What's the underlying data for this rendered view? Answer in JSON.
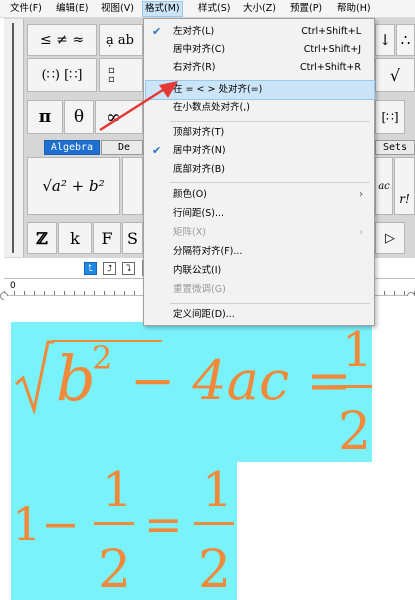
{
  "menubar": {
    "items": [
      "文件(F)",
      "编辑(E)",
      "视图(V)",
      "格式(M)",
      "样式(S)",
      "大小(Z)",
      "预置(P)",
      "帮助(H)"
    ],
    "active_index": 3
  },
  "palette": {
    "row1": [
      "≤ ≠ ≈",
      "ạ ab",
      "↓",
      "∴"
    ],
    "row2": [
      "(∷) [∷]",
      "√"
    ],
    "row3": [
      "π",
      "θ",
      "∞",
      "[∷]"
    ],
    "tabs": [
      "Algebra",
      "De",
      "Sets"
    ],
    "template_sqrt": "√a² + b²",
    "row5": [
      "ℤ",
      "k",
      "F",
      "S",
      "▷"
    ],
    "ruler_zero": "0"
  },
  "format_menu": {
    "items": [
      {
        "label": "左对齐(L)",
        "shortcut": "Ctrl+Shift+L",
        "checked": true
      },
      {
        "label": "居中对齐(C)",
        "shortcut": "Ctrl+Shift+J"
      },
      {
        "label": "右对齐(R)",
        "shortcut": "Ctrl+Shift+R"
      },
      {
        "label": "在 = < > 处对齐(=)",
        "highlighted": true
      },
      {
        "label": "在小数点处对齐(,)"
      },
      {
        "label": "顶部对齐(T)"
      },
      {
        "label": "居中对齐(N)",
        "checked": true
      },
      {
        "label": "底部对齐(B)"
      },
      {
        "label": "颜色(O)",
        "submenu": true
      },
      {
        "label": "行间距(S)..."
      },
      {
        "label": "矩阵(X)",
        "submenu": true,
        "disabled": true
      },
      {
        "label": "分隔符对齐(F)..."
      },
      {
        "label": "内联公式(I)"
      },
      {
        "label": "重置微调(G)",
        "disabled": true
      },
      {
        "label": "定义间距(D)..."
      }
    ]
  },
  "equations": {
    "eq1_b": "b",
    "eq1_sup": "2",
    "eq1_rest": "− 4ac =",
    "eq1_num": "1",
    "eq1_den": "2",
    "eq2_one": "1−",
    "eq2_num": "1",
    "eq2_den": "2",
    "eq2_eq": "=",
    "eq2_rnum": "1",
    "eq2_rden": "2"
  },
  "colors": {
    "highlight": "#7af2fb",
    "equation": "#f08a3a",
    "tab_active": "#1f6fd1",
    "arrow": "#e53935",
    "check": "#2a72c8"
  }
}
